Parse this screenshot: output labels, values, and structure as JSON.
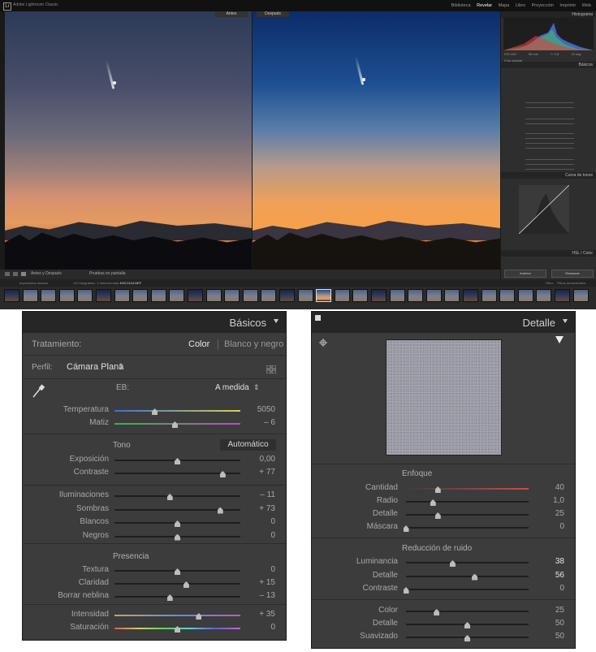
{
  "lightroom": {
    "app_title": "Adobe Lightroom Classic",
    "modules": [
      "Biblioteca",
      "Revelar",
      "Mapa",
      "Libro",
      "Proyección",
      "Imprimir",
      "Web"
    ],
    "active_module": "Revelar",
    "before_label": "Antes",
    "after_label": "Después",
    "view_toolbar": {
      "mode": "Antes y Después",
      "soft_proof": "Pruebas en pantalla"
    },
    "right_panel": {
      "histogram_title": "Histograma",
      "histogram_info": [
        "ISO 400",
        "50 mm",
        "f / 2,8",
        "13 seg"
      ],
      "original_photo": "Foto original",
      "basic_title": "Básicos",
      "curve_title": "Curva de tonos",
      "hsl_title": "HSL / Color",
      "copy_button": "Anterior",
      "reset_button": "Restaurar"
    },
    "filmstrip_bar": {
      "source": "Importación anterior",
      "count": "112 fotografías / 1 seleccionada /",
      "filename": "DSC1104.NEF",
      "filter_label": "Filtro:",
      "filter_value": "Filtros desactivados"
    }
  },
  "basicos": {
    "title": "Básicos",
    "treatment_label": "Tratamiento:",
    "treatment_color": "Color",
    "treatment_bw": "Blanco y negro",
    "profile_label": "Perfil:",
    "profile_value": "Cámara Plana",
    "wb_label": "EB:",
    "wb_value": "A medida",
    "sliders_wb": [
      {
        "label": "Temperatura",
        "value": "5050",
        "pos": 0.32
      },
      {
        "label": "Matiz",
        "value": "– 6",
        "pos": 0.48
      }
    ],
    "tone_label": "Tono",
    "auto_button": "Automático",
    "sliders_tone": [
      {
        "label": "Exposición",
        "value": "0,00",
        "pos": 0.5
      },
      {
        "label": "Contraste",
        "value": "+ 77",
        "pos": 0.86
      }
    ],
    "sliders_tone2": [
      {
        "label": "Iluminaciones",
        "value": "– 11",
        "pos": 0.44
      },
      {
        "label": "Sombras",
        "value": "+ 73",
        "pos": 0.84
      },
      {
        "label": "Blancos",
        "value": "0",
        "pos": 0.5
      },
      {
        "label": "Negros",
        "value": "0",
        "pos": 0.5
      }
    ],
    "presence_label": "Presencia",
    "sliders_presence": [
      {
        "label": "Textura",
        "value": "0",
        "pos": 0.5
      },
      {
        "label": "Claridad",
        "value": "+ 15",
        "pos": 0.57
      },
      {
        "label": "Borrar neblina",
        "value": "– 13",
        "pos": 0.44
      }
    ],
    "sliders_presence2": [
      {
        "label": "Intensidad",
        "value": "+ 35",
        "pos": 0.67
      },
      {
        "label": "Saturación",
        "value": "0",
        "pos": 0.5
      }
    ]
  },
  "detalle": {
    "title": "Detalle",
    "sharpen_label": "Enfoque",
    "sliders_sharpen": [
      {
        "label": "Cantidad",
        "value": "40",
        "pos": 0.26
      },
      {
        "label": "Radio",
        "value": "1,0",
        "pos": 0.22
      },
      {
        "label": "Detalle",
        "value": "25",
        "pos": 0.26
      },
      {
        "label": "Máscara",
        "value": "0",
        "pos": 0.0
      }
    ],
    "nr_label": "Reducción de ruido",
    "sliders_nr": [
      {
        "label": "Luminancia",
        "value": "38",
        "pos": 0.38,
        "bright": true
      },
      {
        "label": "Detalle",
        "value": "56",
        "pos": 0.56,
        "bright": true
      },
      {
        "label": "Contraste",
        "value": "0",
        "pos": 0.0
      }
    ],
    "sliders_color": [
      {
        "label": "Color",
        "value": "25",
        "pos": 0.25
      },
      {
        "label": "Detalle",
        "value": "50",
        "pos": 0.5
      },
      {
        "label": "Suavizado",
        "value": "50",
        "pos": 0.5
      }
    ]
  },
  "colors": {
    "panel_bg": "#3c3c3c",
    "temp_gradient": [
      "#3a6fd8",
      "#d8d24a"
    ],
    "tint_gradient": [
      "#3ab34a",
      "#c24ac0"
    ],
    "vib_gradient": [
      "#d0a060",
      "#5a8fe0",
      "#c25ac0"
    ],
    "sharpen_amount_gradient": [
      "#3c3c3c",
      "#d04a4a"
    ]
  }
}
